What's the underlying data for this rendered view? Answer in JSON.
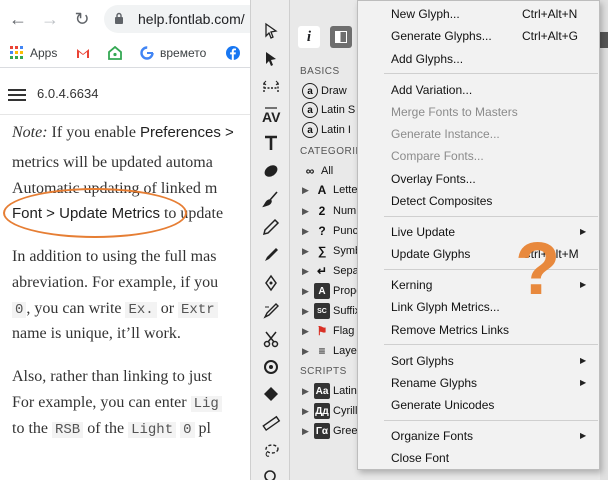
{
  "browser": {
    "url": "help.fontlab.com/",
    "bookmarks": [
      {
        "label": "Apps",
        "icon": "apps-grid-icon"
      },
      {
        "label": "",
        "icon": "gmail-icon"
      },
      {
        "label": "",
        "icon": "home-icon"
      },
      {
        "label": "времето",
        "icon": "google-icon"
      },
      {
        "label": "",
        "icon": "facebook-icon"
      }
    ]
  },
  "site": {
    "version": "6.0.4.6634"
  },
  "article": {
    "line1": {
      "note": "Note:",
      "text": " If you enable ",
      "ui": "Preferences >"
    },
    "line2": "metrics will be updated automa",
    "line3": "Automatic updating of linked m",
    "line4": {
      "ui": "Font > Update Metrics",
      "text": " to update"
    },
    "line5": "In addition to using the full mas",
    "line6": "abreviation. For example, if you",
    "line7": {
      "code1": "0",
      "text1": ", you can write ",
      "code2": "Ex.",
      "text2": " or ",
      "code3": "Extr"
    },
    "line8": "name is unique, it’ll work.",
    "line9": "Also, rather than linking to just",
    "line10": {
      "text": "For example, you can enter ",
      "code": "Lig"
    },
    "line11": {
      "t1": "to the ",
      "c1": "RSB",
      "t2": " of the ",
      "c2": "Light",
      "t3": " ",
      "c3": "0",
      "t4": " pl"
    }
  },
  "panel": {
    "info_tab": "i",
    "sections": {
      "basics": "BASICS",
      "categories": "CATEGORIES",
      "scripts": "SCRIPTS"
    },
    "basics": [
      "Draw",
      "Latin S",
      "Latin I"
    ],
    "categories": [
      "All",
      "Letter",
      "Numb",
      "Punct",
      "Symbo",
      "Separ",
      "Prope",
      "Suffix",
      "Flag",
      "Layer"
    ],
    "category_glyphs": [
      "∞",
      "A",
      "2",
      "?",
      "∑",
      "↵",
      "A",
      "SC",
      "⚑",
      "≡"
    ],
    "scripts": [
      "Latin",
      "Cyrilli",
      "Greek"
    ],
    "script_glyphs": [
      "Aa",
      "Дд",
      "Γα"
    ]
  },
  "menu": {
    "groups": [
      [
        {
          "label": "New Glyph...",
          "shortcut": "Ctrl+Alt+N"
        },
        {
          "label": "Generate Glyphs...",
          "shortcut": "Ctrl+Alt+G"
        },
        {
          "label": "Add Glyphs..."
        }
      ],
      [
        {
          "label": "Add Variation..."
        },
        {
          "label": "Merge Fonts to Masters",
          "disabled": true
        },
        {
          "label": "Generate Instance...",
          "disabled": true
        },
        {
          "label": "Compare Fonts...",
          "disabled": true
        },
        {
          "label": "Overlay Fonts..."
        },
        {
          "label": "Detect Composites"
        }
      ],
      [
        {
          "label": "Live Update",
          "submenu": true
        },
        {
          "label": "Update Glyphs",
          "shortcut": "Ctrl+Alt+M"
        }
      ],
      [
        {
          "label": "Kerning",
          "submenu": true
        },
        {
          "label": "Link Glyph Metrics..."
        },
        {
          "label": "Remove Metrics Links"
        }
      ],
      [
        {
          "label": "Sort Glyphs",
          "submenu": true
        },
        {
          "label": "Rename Glyphs",
          "submenu": true
        },
        {
          "label": "Generate Unicodes"
        }
      ],
      [
        {
          "label": "Organize Fonts",
          "submenu": true
        },
        {
          "label": "Close Font"
        }
      ]
    ]
  },
  "annotation": {
    "question_mark": "?",
    "accent_color": "#e8893d"
  }
}
